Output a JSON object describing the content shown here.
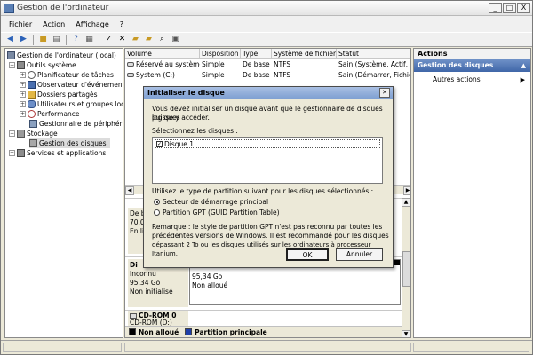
{
  "window": {
    "title": "Gestion de l'ordinateur",
    "min": "_",
    "max": "□",
    "close": "X"
  },
  "menu": [
    "Fichier",
    "Action",
    "Affichage",
    "?"
  ],
  "tree": {
    "root": "Gestion de l'ordinateur (local)",
    "outils": "Outils système",
    "planif": "Planificateur de tâches",
    "observ": "Observateur d'événements",
    "dossiers": "Dossiers partagés",
    "users": "Utilisateurs et groupes locaux",
    "perf": "Performance",
    "periph": "Gestionnaire de périphériques",
    "stockage": "Stockage",
    "disques": "Gestion des disques",
    "services": "Services et applications"
  },
  "table": {
    "columns": [
      "Volume",
      "Disposition",
      "Type",
      "Système de fichiers",
      "Statut"
    ],
    "rows": [
      [
        "Réservé au système",
        "Simple",
        "De base",
        "NTFS",
        "Sain (Système, Actif, Par"
      ],
      [
        "System (C:)",
        "Simple",
        "De base",
        "NTFS",
        "Sain (Démarrer, Fichier d"
      ]
    ]
  },
  "disks": {
    "d0_l1": "De b",
    "d0_l2": "70,0",
    "d0_l3": "En lig",
    "d1_name": "Di",
    "d1_type": "Inconnu",
    "d1_size": "95,34 Go",
    "d1_state": "Non initialisé",
    "d1_vol_size": "95,34 Go",
    "d1_vol_state": "Non alloué",
    "cd_name": "CD-ROM 0",
    "cd_drive": "CD-ROM (D:)"
  },
  "legend": {
    "unalloc": "Non alloué",
    "primary": "Partition principale"
  },
  "actions": {
    "header": "Actions",
    "selected": "Gestion des disques",
    "more": "Autres actions"
  },
  "dialog": {
    "title": "Initialiser le disque",
    "intro1": "Vous devez initialiser un disque avant que le gestionnaire de disques logiques",
    "intro2": "puisse y accéder.",
    "select_label": "Sélectionnez les disques :",
    "disk_item": "Disque 1",
    "partition_label": "Utilisez le type de partition suivant pour les disques sélectionnés :",
    "opt_mbr": "Secteur de démarrage principal",
    "opt_gpt": "Partition GPT (GUID Partition Table)",
    "note1": "Remarque : le style de partition GPT n'est pas reconnu par toutes les",
    "note2": "précédentes versions de Windows. Il est recommandé pour les disques",
    "note3": "dépassant 2 To ou les disques utilisés sur les ordinateurs à processeur Itanium.",
    "ok": "OK",
    "cancel": "Annuler"
  },
  "colors": {
    "accent": "#3f66a8",
    "primary_partition": "#1f3fa8",
    "unallocated": "#000000"
  }
}
